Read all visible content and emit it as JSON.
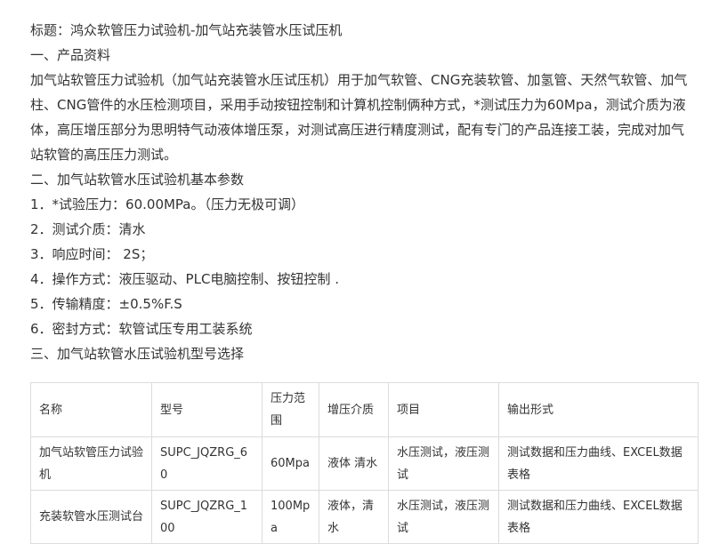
{
  "doc": {
    "title_line": "标题：鸿众软管压力试验机-加气站充装管水压试压机",
    "section1": "一、产品资料",
    "intro": "加气站软管压力试验机（加气站充装管水压试压机）用于加气软管、CNG充装软管、加氢管、天然气软管、加气柱、CNG管件的水压检测项目，采用手动按钮控制和计算机控制俩种方式，*测试压力为60Mpa，测试介质为液体，高压增压部分为思明特气动液体增压泵，对测试高压进行精度测试，配有专门的产品连接工装，完成对加气站软管的高压压力测试。",
    "section2": "二、加气站软管水压试验机基本参数",
    "params": [
      "1．*试验压力：60.00MPa。（压力无极可调）",
      "2．测试介质：清水",
      "3．响应时间： 2S；",
      "4．操作方式：液压驱动、PLC电脑控制、按钮控制 .",
      "5．传输精度：±0.5%F.S",
      "6．密封方式：软管试压专用工装系统"
    ],
    "section3": "三、加气站软管水压试验机型号选择"
  },
  "table": {
    "headers": [
      "名称",
      "型号",
      "压力范围",
      "增压介质",
      "项目",
      "输出形式"
    ],
    "rows": [
      [
        "加气站软管压力试验机",
        "SUPC_JQZRG_60",
        "60Mpa",
        "液体 清水",
        "水压测试，液压测试",
        "测试数据和压力曲线、EXCEL数据表格"
      ],
      [
        "充装软管水压测试台",
        "SUPC_JQZRG_100",
        "100Mpa",
        "液体，清水",
        "水压测试，液压测试",
        "测试数据和压力曲线、EXCEL数据表格"
      ]
    ]
  }
}
